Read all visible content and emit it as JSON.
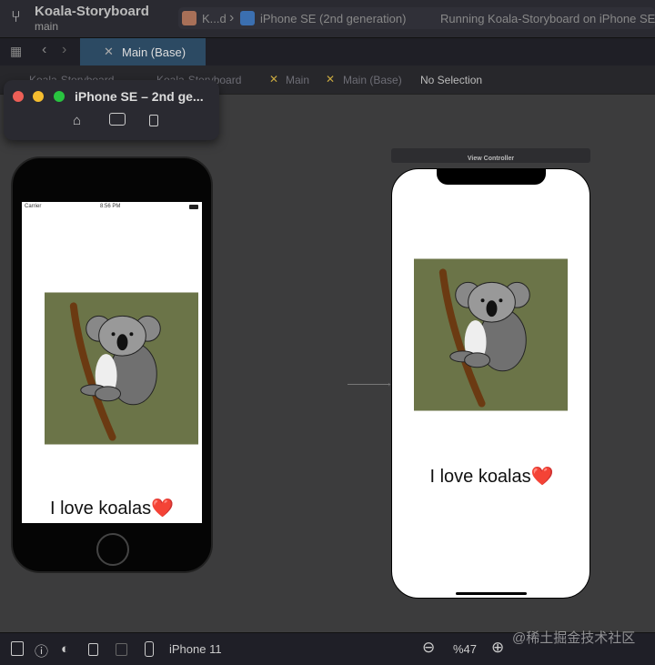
{
  "titlebar": {
    "project": "Koala-Storyboard",
    "branch": "main",
    "scheme": "K...d",
    "device": "iPhone SE (2nd generation)",
    "status": "Running Koala-Storyboard on iPhone SE"
  },
  "tabs": [
    {
      "label": "Main (Base)"
    }
  ],
  "breadcrumb": [
    "Koala-Storyboard",
    "Koala-Storyboard",
    "Main",
    "Main (Base)",
    "No Selection"
  ],
  "simulator": {
    "title": "iPhone SE – 2nd ge...",
    "carrier": "Carrier",
    "time": "8:56 PM",
    "label": "I love koalas❤️"
  },
  "storyboard": {
    "scene_title": "View Controller",
    "label": "I love koalas❤️"
  },
  "bottombar": {
    "device": "iPhone 11",
    "zoom": "%47",
    "watermark": "@稀土掘金技术社区"
  },
  "colors": {
    "tab_active": "#2c4a63",
    "koala_bg": "#6b7448"
  }
}
